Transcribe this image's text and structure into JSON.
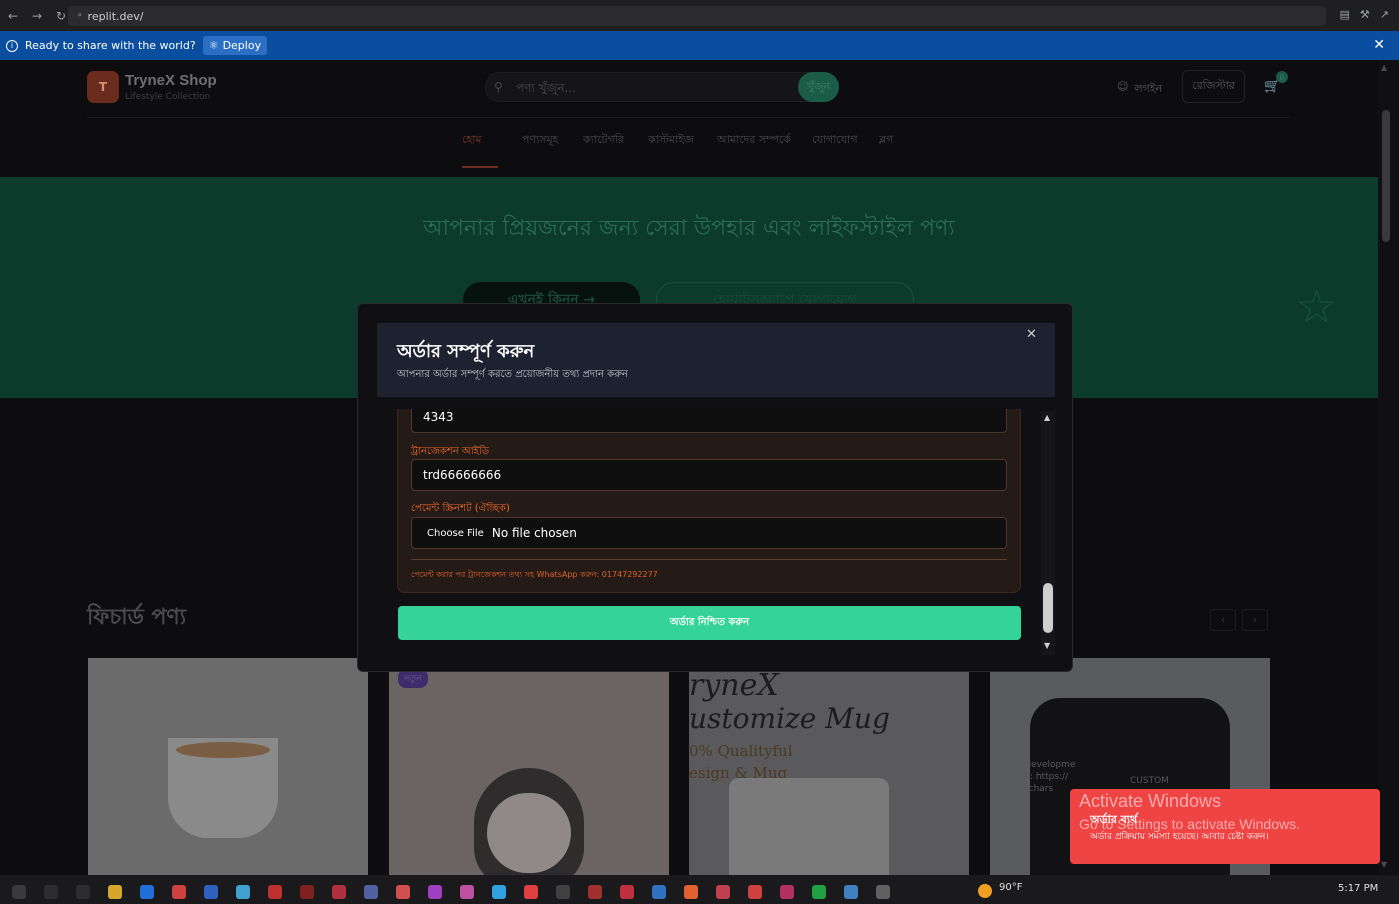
{
  "browser": {
    "url": "replit.dev/",
    "back_icon": "arrow-left-icon",
    "forward_icon": "arrow-right-icon",
    "reload_icon": "reload-icon"
  },
  "share_bar": {
    "message": "Ready to share with the world?",
    "deploy_label": "Deploy"
  },
  "site": {
    "logo_letter": "T",
    "logo_name": "TryneX Shop",
    "logo_sub": "Lifestyle Collection",
    "search_placeholder": "পণ্য খুঁজুন...",
    "search_button": "খুঁজুন",
    "login_label": "লগইন",
    "register_label": "রেজিস্টার",
    "cart_count": "0",
    "nav": [
      "হোম",
      "পণ্যসমূহ",
      "ক্যাটেগরি",
      "কাস্টমাইজ",
      "আমাদের সম্পর্কে",
      "যোগাযোগ",
      "ব্লগ"
    ],
    "hero_title": "আপনার প্রিয়জনের জন্য সেরা উপহার এবং লাইফস্টাইল পণ্য",
    "hero_btn1": "এখনই কিনুন →",
    "hero_btn2": "হোয়াটসঅ্যাপে যোগাযোগ",
    "featured_title": "ফিচার্ড পণ্য",
    "badge_new": "নতুন",
    "mug_line1": "ryneX",
    "mug_line2": "ustomize Mug",
    "mug_line3": "0% Qualityful",
    "mug_line4": "esign & Mug",
    "shirt_text": "CUSTOM",
    "dev_info_1": "Mode: developme",
    "dev_info_2": "API URL: https://",
    "dev_info_3": "Cart: 0 chars"
  },
  "modal": {
    "title": "অর্ডার সম্পূর্ণ করুন",
    "subtitle": "আপনার অর্ডার সম্পূর্ণ করতে প্রয়োজনীয় তথ্য প্রদান করুন",
    "field_top_value": "4343",
    "transaction_label": "ট্রানজেকশন আইডি",
    "transaction_value": "trd66666666",
    "screenshot_label": "পেমেন্ট স্ক্রিনশট (ঐচ্ছিক)",
    "file_button": "Choose File",
    "file_status": "No file chosen",
    "note": "পেমেন্ট করার পর ট্রানজেকশন তথ্য সহ WhatsApp করুন: 01747292277",
    "confirm_button": "অর্ডার নিশ্চিত করুন",
    "close_icon": "close-icon"
  },
  "toast": {
    "title": "অর্ডার ব্যর্থ",
    "message": "অর্ডার প্রক্রিয়ায় সমস্যা হয়েছে। আবার চেষ্টা করুন।",
    "color": "#ef4444"
  },
  "watermark": {
    "line1": "Activate Windows",
    "line2": "Go to Settings to activate Windows."
  },
  "taskbar": {
    "weather": "90°F",
    "time": "5:17 PM"
  },
  "colors": {
    "accent": "#34d399",
    "label": "#f06a2c",
    "share_bar": "#0b4e9f"
  }
}
